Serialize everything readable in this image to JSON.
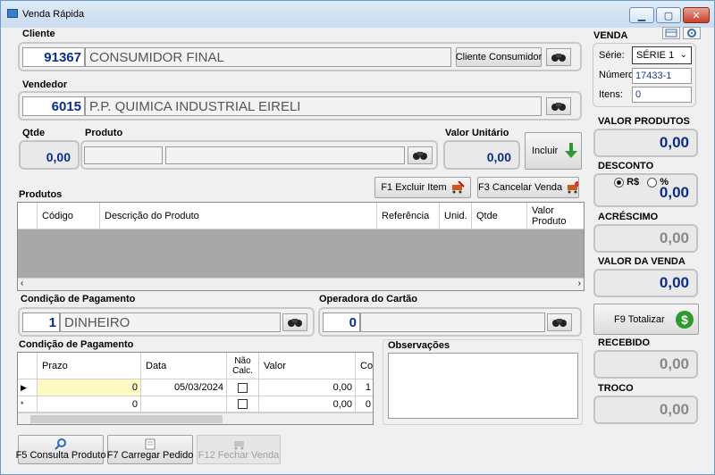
{
  "window": {
    "title": "Venda Rápida"
  },
  "cliente": {
    "label": "Cliente",
    "code": "91367",
    "name": "CONSUMIDOR FINAL",
    "consumidor_button": "Cliente Consumidor"
  },
  "vendedor": {
    "label": "Vendedor",
    "code": "6015",
    "name": "P.P. QUIMICA INDUSTRIAL EIRELI"
  },
  "produto_entry": {
    "qtde_label": "Qtde",
    "qtde_value": "0,00",
    "produto_label": "Produto",
    "valor_unitario_label": "Valor Unitário",
    "valor_unitario_value": "0,00",
    "incluir_button": "Incluir"
  },
  "produtos": {
    "label": "Produtos",
    "excluir_button": "F1 Excluir Item",
    "cancelar_button": "F3 Cancelar Venda",
    "columns": [
      "Código",
      "Descrição do Produto",
      "Referência",
      "Unid.",
      "Qtde",
      "Valor Produto"
    ]
  },
  "condicao_pagamento": {
    "label": "Condição de Pagamento",
    "code": "1",
    "name": "DINHEIRO"
  },
  "operadora": {
    "label": "Operadora do Cartão",
    "code": "0"
  },
  "parcelas": {
    "label": "Condição de Pagamento",
    "columns": [
      "Prazo",
      "Data",
      "Não Calc.",
      "Valor",
      "Cod"
    ],
    "rows": [
      {
        "marker": "▶",
        "prazo": "0",
        "data": "05/03/2024",
        "valor": "0,00",
        "cod": "1"
      },
      {
        "marker": "*",
        "prazo": "0",
        "data": "",
        "valor": "0,00",
        "cod": "0"
      }
    ]
  },
  "observacoes": {
    "label": "Observações"
  },
  "bottom_buttons": {
    "consulta": "F5 Consulta Produto",
    "carregar": "F7 Carregar Pedido",
    "fechar": "F12 Fechar Venda"
  },
  "venda": {
    "label": "VENDA",
    "serie_label": "Série:",
    "serie_value": "SÉRIE 1",
    "numero_label": "Número:",
    "numero_value": "17433-1",
    "itens_label": "Itens:",
    "itens_value": "0"
  },
  "totais": {
    "valor_produtos_label": "VALOR PRODUTOS",
    "valor_produtos": "0,00",
    "desconto_label": "DESCONTO",
    "desconto_rs": "R$",
    "desconto_pct": "%",
    "desconto": "0,00",
    "acrescimo_label": "ACRÉSCIMO",
    "acrescimo": "0,00",
    "valor_venda_label": "VALOR DA VENDA",
    "valor_venda": "0,00",
    "totalizar_button": "F9 Totalizar",
    "recebido_label": "RECEBIDO",
    "recebido": "0,00",
    "troco_label": "TROCO",
    "troco": "0,00"
  },
  "colors": {
    "code_blue": "#0c2c8a",
    "grid_gray": "#a8a8a8",
    "highlight_yellow": "#fff9c4"
  }
}
